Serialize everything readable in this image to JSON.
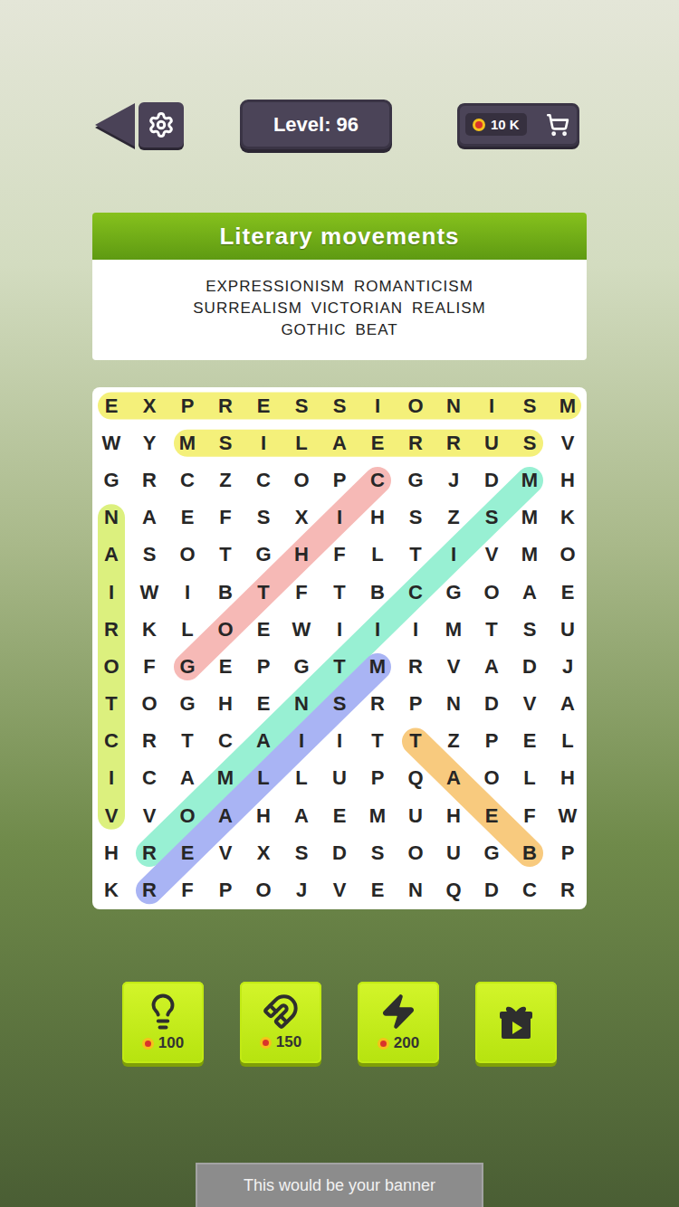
{
  "topbar": {
    "level": "Level: 96",
    "coins": "10 K"
  },
  "category": {
    "title": "Literary movements",
    "word_lines": [
      [
        "EXPRESSIONISM",
        "ROMANTICISM"
      ],
      [
        "SURREALISM",
        "VICTORIAN",
        "REALISM"
      ],
      [
        "GOTHIC",
        "BEAT"
      ]
    ]
  },
  "grid": {
    "rows": [
      "EXPRESSIONISM",
      "WYMSILAERRUSV",
      "GRCZCOPCGJDMH",
      "NAEFSXIHSZSMK",
      "ASOTGHFLTIVMO",
      "IWIBTFTBCGOAE",
      "RKLOEWIIIMTSU",
      "OFGEPGTMRVADJ",
      "TOGHENSRPNDVA",
      "CRTCAIITTZPEL",
      "ICAMLLUPQAOLH",
      "VVOAHAEMUHEFW",
      "HREVXSDSOUGBP",
      "KRFPOJVENQDCR"
    ]
  },
  "found_words": [
    {
      "word": "EXPRESSIONISM",
      "start": [
        0,
        0
      ],
      "end": [
        0,
        12
      ],
      "color": "#f4f07a"
    },
    {
      "word": "SURREALISM",
      "start": [
        1,
        11
      ],
      "end": [
        1,
        2
      ],
      "color": "#f4f07a"
    },
    {
      "word": "VICTORIAN",
      "start": [
        11,
        0
      ],
      "end": [
        3,
        0
      ],
      "color": "#dcf07e"
    },
    {
      "word": "GOTHIC",
      "start": [
        7,
        2
      ],
      "end": [
        2,
        7
      ],
      "color": "#f6b9b6"
    },
    {
      "word": "ROMANTICISM",
      "start": [
        12,
        1
      ],
      "end": [
        2,
        11
      ],
      "color": "#98f0d3"
    },
    {
      "word": "REALISM",
      "start": [
        13,
        1
      ],
      "end": [
        7,
        7
      ],
      "color": "#a9b4f4"
    },
    {
      "word": "BEAT",
      "start": [
        12,
        11
      ],
      "end": [
        9,
        8
      ],
      "color": "#f8ca7e"
    }
  ],
  "boosters": [
    {
      "kind": "hint",
      "cost": "100"
    },
    {
      "kind": "magnet",
      "cost": "150"
    },
    {
      "kind": "lightning",
      "cost": "200"
    },
    {
      "kind": "video"
    }
  ],
  "banner": "This would be your banner"
}
